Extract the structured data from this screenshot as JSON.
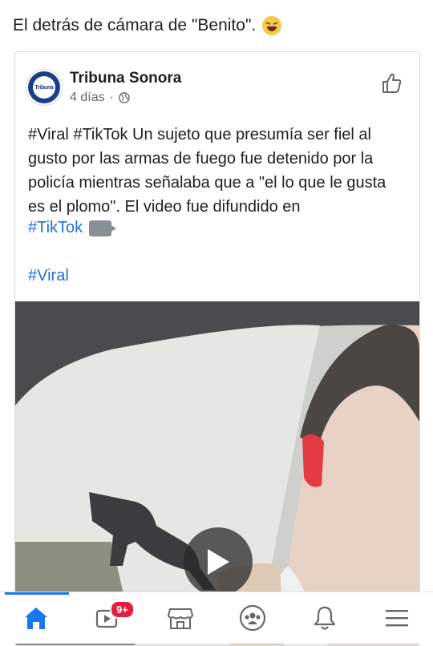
{
  "caption": {
    "text": "El detrás de cámara de \"Benito\"."
  },
  "post": {
    "page_name": "Tribuna Sonora",
    "avatar_text": "Tribuna",
    "time": "4 días",
    "separator": "·",
    "body": "#Viral #TikTok Un sujeto que presumía ser fiel al gusto por las armas de fuego fue detenido por la policía mientras señalaba que a \"el lo que le gusta es el plomo\". El video fue difundido en",
    "tag_tiktok": "#TikTok",
    "tag_viral": "#Viral"
  },
  "nav": {
    "items": [
      "home-icon",
      "video-icon",
      "marketplace-icon",
      "groups-icon",
      "bell-icon",
      "menu-icon"
    ],
    "video_badge": "9+",
    "active_color": "#1877f2"
  },
  "colors": {
    "link": "#216fdb",
    "accent": "#1877f2",
    "badge": "#e41e3f"
  }
}
